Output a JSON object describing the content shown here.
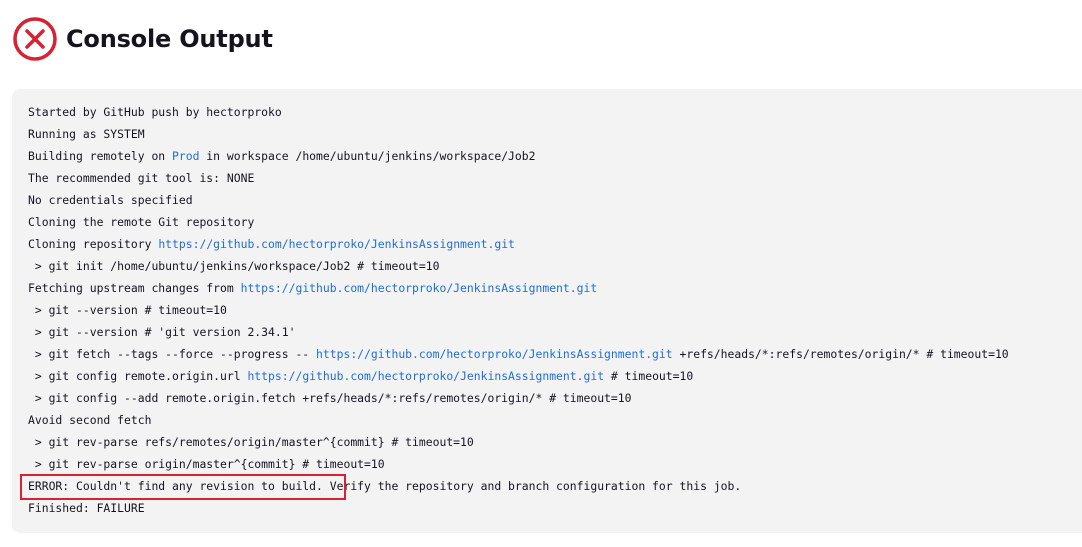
{
  "page": {
    "title": "Console Output"
  },
  "status_icon": {
    "name": "x-circle-icon",
    "color": "#d62232"
  },
  "console": {
    "lines": [
      [
        {
          "t": "Started by GitHub push by hectorproko"
        }
      ],
      [
        {
          "t": "Running as SYSTEM"
        }
      ],
      [
        {
          "t": "Building remotely on "
        },
        {
          "t": "Prod",
          "link": true
        },
        {
          "t": " in workspace /home/ubuntu/jenkins/workspace/Job2"
        }
      ],
      [
        {
          "t": "The recommended git tool is: NONE"
        }
      ],
      [
        {
          "t": "No credentials specified"
        }
      ],
      [
        {
          "t": "Cloning the remote Git repository"
        }
      ],
      [
        {
          "t": "Cloning repository "
        },
        {
          "t": "https://github.com/hectorproko/JenkinsAssignment.git",
          "link": true
        }
      ],
      [
        {
          "t": " > git init /home/ubuntu/jenkins/workspace/Job2 # timeout=10"
        }
      ],
      [
        {
          "t": "Fetching upstream changes from "
        },
        {
          "t": "https://github.com/hectorproko/JenkinsAssignment.git",
          "link": true
        }
      ],
      [
        {
          "t": " > git --version # timeout=10"
        }
      ],
      [
        {
          "t": " > git --version # 'git version 2.34.1'"
        }
      ],
      [
        {
          "t": " > git fetch --tags --force --progress -- "
        },
        {
          "t": "https://github.com/hectorproko/JenkinsAssignment.git",
          "link": true
        },
        {
          "t": " +refs/heads/*:refs/remotes/origin/* # timeout=10"
        }
      ],
      [
        {
          "t": " > git config remote.origin.url "
        },
        {
          "t": "https://github.com/hectorproko/JenkinsAssignment.git",
          "link": true
        },
        {
          "t": " # timeout=10"
        }
      ],
      [
        {
          "t": " > git config --add remote.origin.fetch +refs/heads/*:refs/remotes/origin/* # timeout=10"
        }
      ],
      [
        {
          "t": "Avoid second fetch"
        }
      ],
      [
        {
          "t": " > git rev-parse refs/remotes/origin/master^{commit} # timeout=10"
        }
      ],
      [
        {
          "t": " > git rev-parse origin/master^{commit} # timeout=10"
        }
      ],
      [
        {
          "t": "ERROR: Couldn't find any revision to build."
        },
        {
          "t": " Verify the repository and branch configuration for this job."
        }
      ],
      [
        {
          "t": "Finished: FAILURE"
        }
      ]
    ]
  },
  "colors": {
    "link": "#1f6ed4",
    "error_highlight": "#d62232",
    "console_background": "#f3f3f4"
  }
}
